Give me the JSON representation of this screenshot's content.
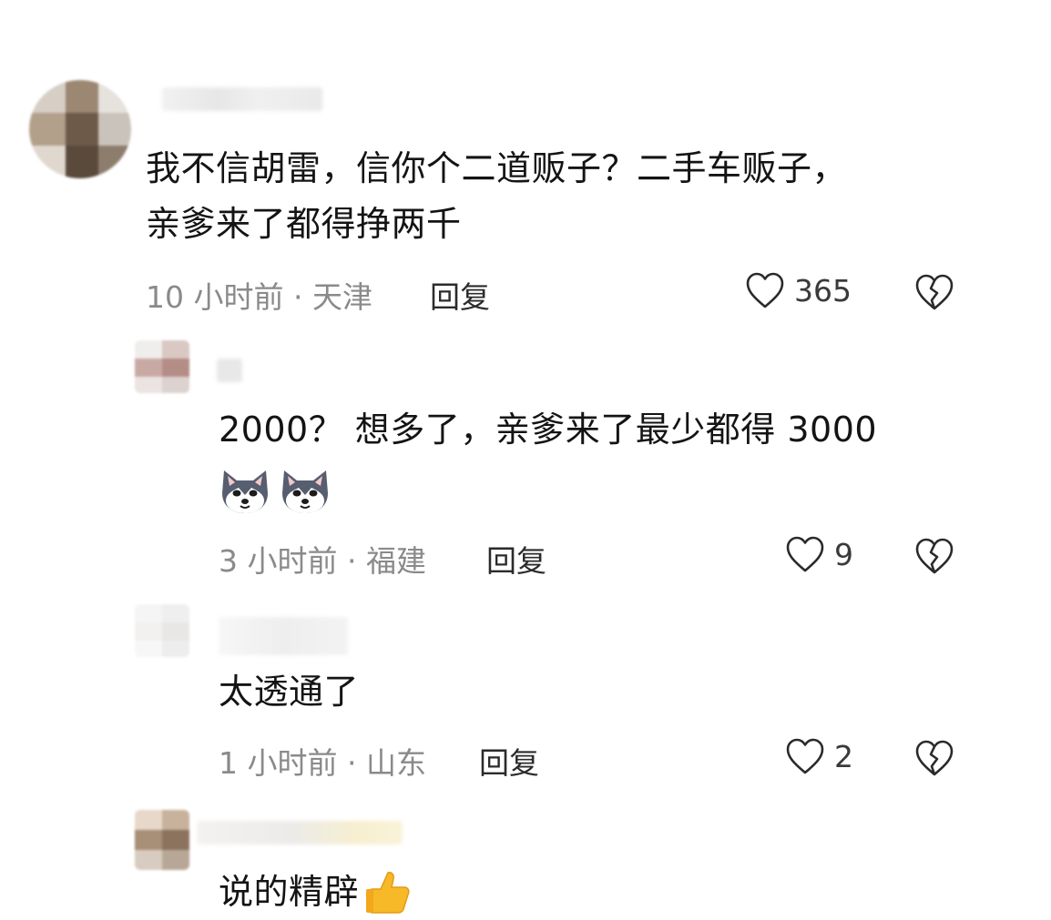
{
  "comments": [
    {
      "text_lines": [
        "我不信胡雷，信你个二道贩子？二手车贩子，",
        "亲爹来了都得挣两千"
      ],
      "meta": "10 小时前 · 天津",
      "reply_label": "回复",
      "likes": "365"
    },
    {
      "text_lines": [
        "2000？ 想多了，亲爹来了最少都得 3000"
      ],
      "emojis": [
        "husky-emoji",
        "husky-emoji"
      ],
      "meta": "3 小时前 · 福建",
      "reply_label": "回复",
      "likes": "9"
    },
    {
      "text_lines": [
        "太透通了"
      ],
      "meta": "1 小时前 · 山东",
      "reply_label": "回复",
      "likes": "2"
    },
    {
      "text_lines": [
        "说的精辟"
      ],
      "emojis": [
        "thumbs-up-emoji"
      ]
    }
  ],
  "colors": {
    "text": "#141414",
    "meta": "#8a8a8a",
    "icon": "#2a2a2a"
  }
}
